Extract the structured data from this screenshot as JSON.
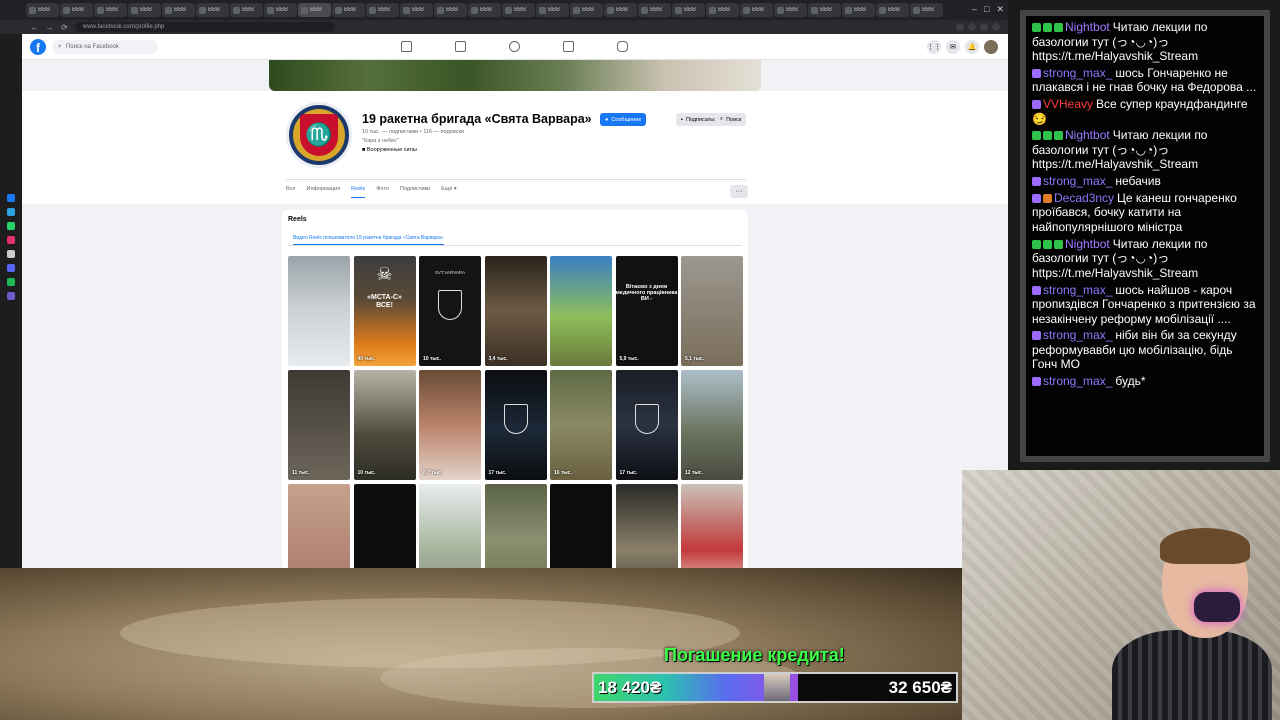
{
  "browser": {
    "tabs": [
      {
        "label": "ВВВ"
      },
      {
        "label": "ВВВ"
      },
      {
        "label": "ВВВ"
      },
      {
        "label": "ВВВ"
      },
      {
        "label": "ВВВ"
      },
      {
        "label": "ВВВ"
      },
      {
        "label": "ВВВ"
      },
      {
        "label": "ВВВ"
      },
      {
        "label": "ВВВ"
      },
      {
        "label": "ВВВ"
      },
      {
        "label": "ВВВ"
      },
      {
        "label": "ВВВ"
      },
      {
        "label": "ВВВ"
      },
      {
        "label": "ВВВ"
      },
      {
        "label": "ВВВ"
      },
      {
        "label": "ВВВ"
      },
      {
        "label": "ВВВ"
      },
      {
        "label": "ВВВ"
      },
      {
        "label": "ВВВ"
      },
      {
        "label": "ВВВ"
      },
      {
        "label": "ВВВ"
      },
      {
        "label": "ВВВ"
      },
      {
        "label": "ВВВ"
      },
      {
        "label": "ВВВ"
      },
      {
        "label": "ВВВ"
      },
      {
        "label": "ВВВ"
      },
      {
        "label": "ВВВ"
      }
    ],
    "url": "www.facebook.com/profile.php",
    "back": "←",
    "forward": "→",
    "reload": "⟳"
  },
  "facebook": {
    "logo": "f",
    "search_placeholder": "Поиск на Facebook",
    "profile": {
      "name": "19 ракетна бригада «Свята Варвара»",
      "stats": "10 тыс. — подписчики • 116 — подписки",
      "slogan": "\"Кара з небес\"",
      "category": "Вооруженные силы",
      "message_btn": "Сообщение",
      "follow_btn": "Подписаться",
      "search_btn": "Поиск",
      "more_btn": "···"
    },
    "tabs": [
      {
        "label": "Все"
      },
      {
        "label": "Информация"
      },
      {
        "label": "Reels"
      },
      {
        "label": "Фото"
      },
      {
        "label": "Подписчики"
      },
      {
        "label": "Ещё ▾"
      }
    ],
    "reels": {
      "title": "Reels",
      "subtitle": "Видео Reels пользователя 19 ракетна бригада «Свята Варвара»",
      "items": [
        {
          "views": "",
          "bg": "linear-gradient(180deg,#9aa4a9 0%,#c9cfd2 45%,#e8ecee 100%)",
          "caption": ""
        },
        {
          "views": "40 тыс.",
          "bg": "linear-gradient(180deg,#3c3c3c 0%,#5a4a36 40%,#e07b1c 80%,#f2a33a 100%)",
          "caption": "«МСТА-С»\nВСЕ!"
        },
        {
          "views": "10 тыс.",
          "bg": "#141414",
          "caption": "SVT.VARVARA"
        },
        {
          "views": "3,4 тыс.",
          "bg": "linear-gradient(180deg,#2a241c 0%,#6d5a45 50%,#3a2f24 100%)",
          "caption": ""
        },
        {
          "views": "",
          "bg": "linear-gradient(180deg,#3a7ec4 0%,#8ebf5a 55%,#6b7a3c 100%)",
          "caption": ""
        },
        {
          "views": "5,9 тыс.",
          "bg": "#111111",
          "caption": "Вітаємо з днем медичного працівника ВИ -"
        },
        {
          "views": "5,1 тыс.",
          "bg": "linear-gradient(180deg,#9c9890 0%,#7a6d5a 100%)",
          "caption": ""
        },
        {
          "views": "11 тыс.",
          "bg": "linear-gradient(180deg,#3e3a33 0%,#6c655a 100%)",
          "caption": ""
        },
        {
          "views": "10 тыс.",
          "bg": "linear-gradient(180deg,#b8b2a6 0%,#4c4a3c 60%,#2e2d24 100%)",
          "caption": ""
        },
        {
          "views": "8,7 тыс.",
          "bg": "linear-gradient(180deg,#6a4c36 0%,#b9826a 50%,#e4d2c8 100%)",
          "caption": ""
        },
        {
          "views": "17 тыс.",
          "bg": "linear-gradient(180deg,#0b0d10 0%,#1c2838 55%,#0b0d10 100%)",
          "caption": ""
        },
        {
          "views": "16 тыс.",
          "bg": "linear-gradient(180deg,#5e6a44 0%,#8a8a64 50%,#6a6040 100%)",
          "caption": ""
        },
        {
          "views": "17 тыс.",
          "bg": "linear-gradient(180deg,#1a1e26 0%,#2b3342 50%,#0d0f14 100%)",
          "caption": ""
        },
        {
          "views": "12 тыс.",
          "bg": "linear-gradient(180deg,#aebfcc 0%,#6c7660 55%,#4a4a40 100%)",
          "caption": ""
        },
        {
          "views": "",
          "bg": "linear-gradient(180deg,#c8a08c 0%,#a6786a 100%)",
          "caption": ""
        },
        {
          "views": "",
          "bg": "#0d0d0d",
          "caption": ""
        },
        {
          "views": "",
          "bg": "linear-gradient(180deg,#e8ecef 0%,#a7b59c 60%,#8a8c86 100%)",
          "caption": ""
        },
        {
          "views": "",
          "bg": "linear-gradient(180deg,#5a6248 0%,#8a9070 50%,#6d7050 100%)",
          "caption": ""
        },
        {
          "views": "",
          "bg": "#0c0c0c",
          "caption": ""
        },
        {
          "views": "",
          "bg": "linear-gradient(180deg,#2a2a26 0%,#8a806a 60%,#4a4638 100%)",
          "caption": ""
        },
        {
          "views": "",
          "bg": "linear-gradient(180deg,#c9c2b8 0%,#c23a3a 60%,#e8d8c8 100%)",
          "caption": ""
        }
      ]
    }
  },
  "chat": {
    "messages": [
      {
        "user": "Nightbot",
        "color": "#9d7dff",
        "badges": [
          "#2fc24a",
          "#2fc24a",
          "#2fc24a"
        ],
        "text": "Читаю лекции по базологии тут (っ◔◡◔)っ https://t.me/Halyavshik_Stream"
      },
      {
        "user": "strong_max_",
        "color": "#8d78ff",
        "badges": [
          "#9b6bff"
        ],
        "text": "шось Гончаренко не плакався і не гнав бочку на Федорова ..."
      },
      {
        "user": "VVHeavy",
        "color": "#ff3a3a",
        "badges": [
          "#9b6bff"
        ],
        "text": "Все супер краундфандинге 😏"
      },
      {
        "user": "Nightbot",
        "color": "#9d7dff",
        "badges": [
          "#2fc24a",
          "#2fc24a",
          "#2fc24a"
        ],
        "text": "Читаю лекции по базологии тут (っ◔◡◔)っ https://t.me/Halyavshik_Stream"
      },
      {
        "user": "strong_max_",
        "color": "#8d78ff",
        "badges": [
          "#9b6bff"
        ],
        "text": "небачив"
      },
      {
        "user": "Decad3ncy",
        "color": "#8d78ff",
        "badges": [
          "#9b6bff",
          "#e07c2a"
        ],
        "text": "Це канеш гончаренко проїбався, бочку катити на найпопулярнішого міністра"
      },
      {
        "user": "Nightbot",
        "color": "#9d7dff",
        "badges": [
          "#2fc24a",
          "#2fc24a",
          "#2fc24a"
        ],
        "text": "Читаю лекции по базологии тут (っ◔◡◔)っ https://t.me/Halyavshik_Stream"
      },
      {
        "user": "strong_max_",
        "color": "#8d78ff",
        "badges": [
          "#9b6bff"
        ],
        "text": "шось найшов - кароч пропиздівся Гончаренко з притензією за незакінчену реформу мобілізації ...."
      },
      {
        "user": "strong_max_",
        "color": "#8d78ff",
        "badges": [
          "#9b6bff"
        ],
        "text": "ніби він би за секунду реформувавби цю мобілізацію, бідь Гонч МО"
      },
      {
        "user": "strong_max_",
        "color": "#8d78ff",
        "badges": [
          "#9b6bff"
        ],
        "text": "будь*"
      }
    ]
  },
  "donation": {
    "title": "Погашение кредита!",
    "current": "18 420₴",
    "goal": "32 650₴",
    "progress": 0.564
  }
}
